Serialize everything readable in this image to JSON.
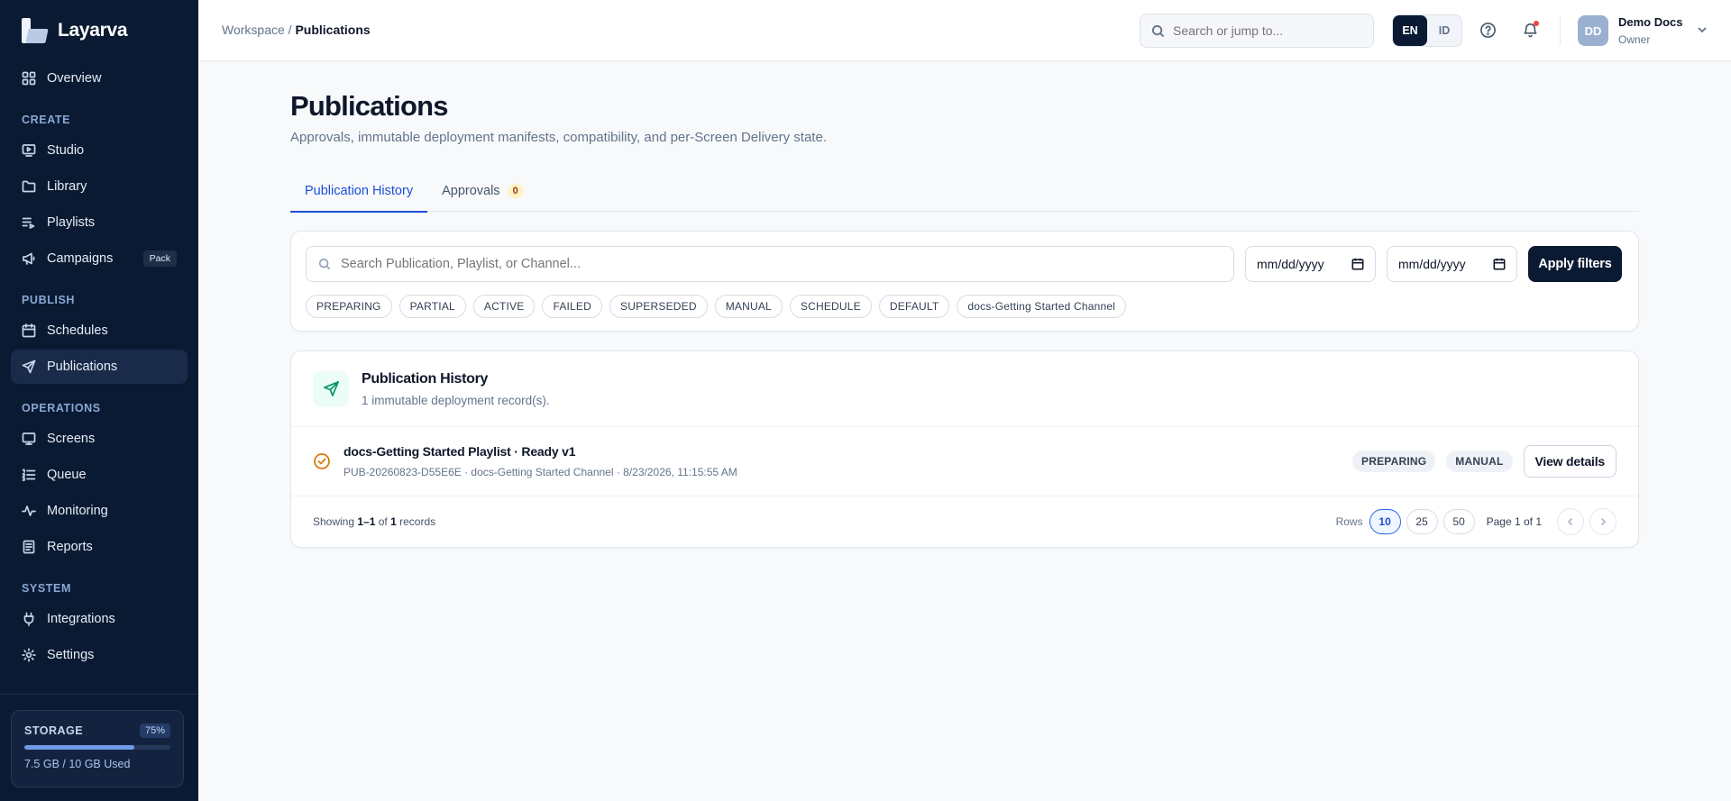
{
  "app": {
    "name": "Layarva"
  },
  "sidebar": {
    "overview": "Overview",
    "sections": {
      "create": "CREATE",
      "publish": "PUBLISH",
      "operations": "OPERATIONS",
      "system": "SYSTEM"
    },
    "items": {
      "studio": "Studio",
      "library": "Library",
      "playlists": "Playlists",
      "campaigns": "Campaigns",
      "campaigns_badge": "Pack",
      "schedules": "Schedules",
      "publications": "Publications",
      "screens": "Screens",
      "queue": "Queue",
      "monitoring": "Monitoring",
      "reports": "Reports",
      "integrations": "Integrations",
      "settings": "Settings"
    },
    "storage": {
      "label": "STORAGE",
      "percent_label": "75%",
      "fraction_used": 0.75,
      "used_text": "7.5 GB / 10 GB Used"
    }
  },
  "topbar": {
    "breadcrumb_root": "Workspace / ",
    "breadcrumb_current": "Publications",
    "search_placeholder": "Search or jump to...",
    "lang_en": "EN",
    "lang_id": "ID",
    "user_initials": "DD",
    "user_name": "Demo Docs",
    "user_role": "Owner"
  },
  "page": {
    "title": "Publications",
    "subtitle": "Approvals, immutable deployment manifests, compatibility, and per-Screen Delivery state.",
    "tabs": {
      "history": "Publication History",
      "approvals": "Approvals",
      "approvals_count": "0"
    }
  },
  "filters": {
    "search_placeholder": "Search Publication, Playlist, or Channel...",
    "date_from": "mm/dd/yyyy",
    "date_to": "mm/dd/yyyy",
    "apply_label": "Apply filters",
    "chips": [
      "PREPARING",
      "PARTIAL",
      "ACTIVE",
      "FAILED",
      "SUPERSEDED",
      "MANUAL",
      "SCHEDULE",
      "DEFAULT",
      "docs-Getting Started Channel"
    ]
  },
  "history": {
    "title": "Publication History",
    "count_text": "1 immutable deployment record(s).",
    "records": [
      {
        "title": "docs-Getting Started Playlist · Ready v1",
        "meta": "PUB-20260823-D55E6E · docs-Getting Started Channel · 8/23/2026, 11:15:55 AM",
        "status": "PREPARING",
        "trigger": "MANUAL",
        "action": "View details"
      }
    ],
    "footer": {
      "showing_prefix": "Showing ",
      "showing_range": "1–1",
      "showing_of": " of ",
      "showing_total": "1",
      "showing_suffix": " records",
      "rows_label": "Rows",
      "rows_options": [
        "10",
        "25",
        "50"
      ],
      "page_info": "Page 1 of 1"
    }
  },
  "colors": {
    "sidebar_bg": "#0b1a33",
    "accent": "#1d4ed8",
    "primary_button": "#0b1a33",
    "status_preparing": "#d97706",
    "success_icon": "#059669"
  }
}
